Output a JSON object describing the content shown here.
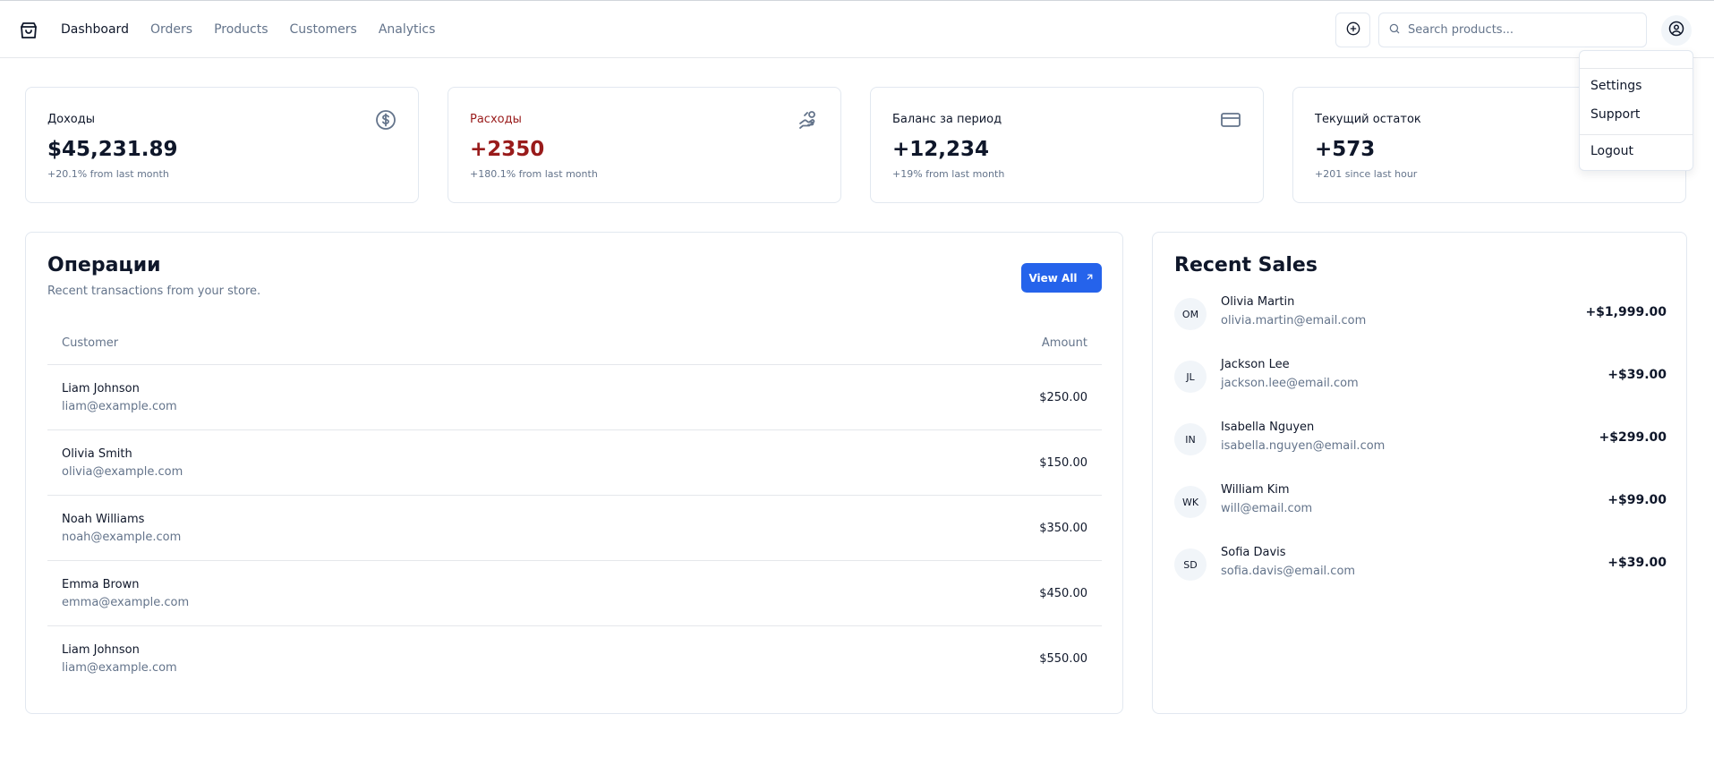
{
  "nav": {
    "brand_icon": "shopping-bag-icon",
    "items": [
      {
        "label": "Dashboard",
        "active": true
      },
      {
        "label": "Orders",
        "active": false
      },
      {
        "label": "Products",
        "active": false
      },
      {
        "label": "Customers",
        "active": false
      },
      {
        "label": "Analytics",
        "active": false
      }
    ]
  },
  "header": {
    "add_icon": "plus-circle-icon",
    "search_icon": "search-icon",
    "search_placeholder": "Search products...",
    "search_value": "",
    "user_icon": "user-circle-icon"
  },
  "user_menu": {
    "items": [
      "Settings",
      "Support",
      "Logout"
    ]
  },
  "stats": [
    {
      "title": "Доходы",
      "value": "$45,231.89",
      "subtitle": "+20.1% from last month",
      "icon": "dollar-circle-icon"
    },
    {
      "title": "Расходы",
      "value": "+2350",
      "subtitle": "+180.1% from last month",
      "icon": "hand-coins-icon"
    },
    {
      "title": "Баланс за период",
      "value": "+12,234",
      "subtitle": "+19% from last month",
      "icon": "credit-card-icon"
    },
    {
      "title": "Текущий остаток",
      "value": "+573",
      "subtitle": "+201 since last hour",
      "icon": ""
    }
  ],
  "operations": {
    "title": "Операции",
    "description": "Recent transactions from your store.",
    "view_all_label": "View All",
    "view_all_icon": "arrow-up-right-icon",
    "columns": [
      "Customer",
      "Amount"
    ],
    "rows": [
      {
        "name": "Liam Johnson",
        "email": "liam@example.com",
        "amount": "$250.00"
      },
      {
        "name": "Olivia Smith",
        "email": "olivia@example.com",
        "amount": "$150.00"
      },
      {
        "name": "Noah Williams",
        "email": "noah@example.com",
        "amount": "$350.00"
      },
      {
        "name": "Emma Brown",
        "email": "emma@example.com",
        "amount": "$450.00"
      },
      {
        "name": "Liam Johnson",
        "email": "liam@example.com",
        "amount": "$550.00"
      }
    ]
  },
  "recent_sales": {
    "title": "Recent Sales",
    "items": [
      {
        "initials": "OM",
        "name": "Olivia Martin",
        "email": "olivia.martin@email.com",
        "amount": "+$1,999.00"
      },
      {
        "initials": "JL",
        "name": "Jackson Lee",
        "email": "jackson.lee@email.com",
        "amount": "+$39.00"
      },
      {
        "initials": "IN",
        "name": "Isabella Nguyen",
        "email": "isabella.nguyen@email.com",
        "amount": "+$299.00"
      },
      {
        "initials": "WK",
        "name": "William Kim",
        "email": "will@email.com",
        "amount": "+$99.00"
      },
      {
        "initials": "SD",
        "name": "Sofia Davis",
        "email": "sofia.davis@email.com",
        "amount": "+$39.00"
      }
    ]
  },
  "colors": {
    "accent": "#2563eb",
    "expense_red": "#991b1b",
    "muted_text": "#64748b",
    "border": "#e2e8f0"
  }
}
